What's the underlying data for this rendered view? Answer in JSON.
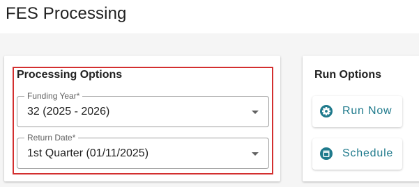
{
  "header": {
    "title": "FES Processing"
  },
  "processing_options": {
    "title": "Processing Options",
    "funding_year": {
      "label": "Funding Year*",
      "value": "32 (2025 - 2026)"
    },
    "return_date": {
      "label": "Return Date*",
      "value": "1st Quarter (01/11/2025)"
    }
  },
  "run_options": {
    "title": "Run Options",
    "run_now_label": "Run Now",
    "schedule_label": "Schedule"
  },
  "colors": {
    "accent": "#1f7a8c",
    "highlight": "#d32f2f"
  },
  "icons": {
    "run_now": "gear-icon",
    "schedule": "calendar-icon",
    "dropdown": "caret-down-icon"
  }
}
